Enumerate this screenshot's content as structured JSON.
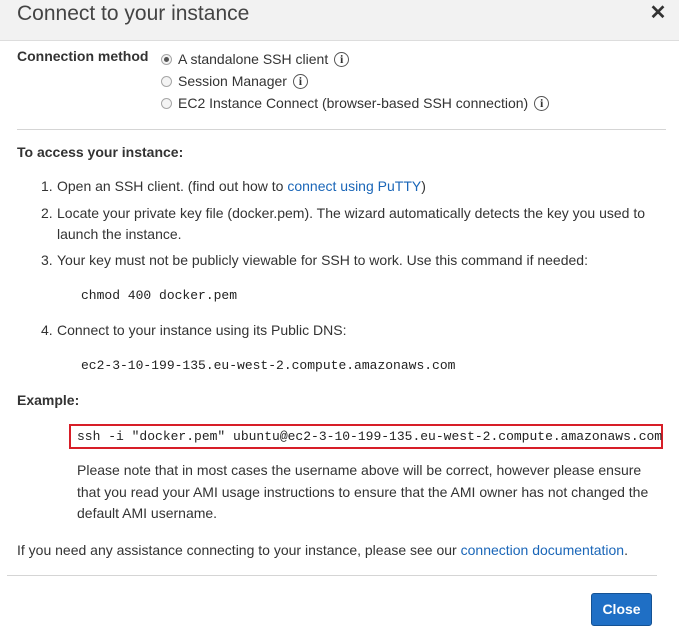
{
  "dialog": {
    "title": "Connect to your instance",
    "close_icon": "close-icon"
  },
  "connection_method": {
    "label": "Connection method",
    "options": [
      {
        "label": "A standalone SSH client",
        "checked": true,
        "info_glyph": "i"
      },
      {
        "label": "Session Manager",
        "checked": false,
        "info_glyph": "i"
      },
      {
        "label": "EC2 Instance Connect (browser-based SSH connection)",
        "checked": false,
        "info_glyph": "i"
      }
    ]
  },
  "access": {
    "heading": "To access your instance:",
    "steps": [
      {
        "num": "1.",
        "text_before": "Open an SSH client. (find out how to ",
        "link": "connect using PuTTY",
        "text_after": ")"
      },
      {
        "num": "2.",
        "line1": "Locate your private key file (docker.pem). The wizard automatically detects the key you used to",
        "line2": "launch the instance."
      },
      {
        "num": "3.",
        "text": "Your key must not be publicly viewable for SSH to work. Use this command if needed:",
        "command": "chmod 400 docker.pem"
      },
      {
        "num": "4.",
        "text": "Connect to your instance using its Public DNS:",
        "command": "ec2-3-10-199-135.eu-west-2.compute.amazonaws.com"
      }
    ]
  },
  "example": {
    "heading": "Example:",
    "command": "ssh -i \"docker.pem\" ubuntu@ec2-3-10-199-135.eu-west-2.compute.amazonaws.com",
    "note": "Please note that in most cases the username above will be correct, however please ensure that you read your AMI usage instructions to ensure that the AMI owner has not changed the default AMI username."
  },
  "assistance": {
    "text": "If you need any assistance connecting to your instance, please see our ",
    "link": "connection documentation",
    "suffix": "."
  },
  "footer": {
    "close_label": "Close"
  },
  "colors": {
    "link": "#1a66b8",
    "primary_button": "#1f6fc5",
    "highlight_border": "#d71e28"
  }
}
